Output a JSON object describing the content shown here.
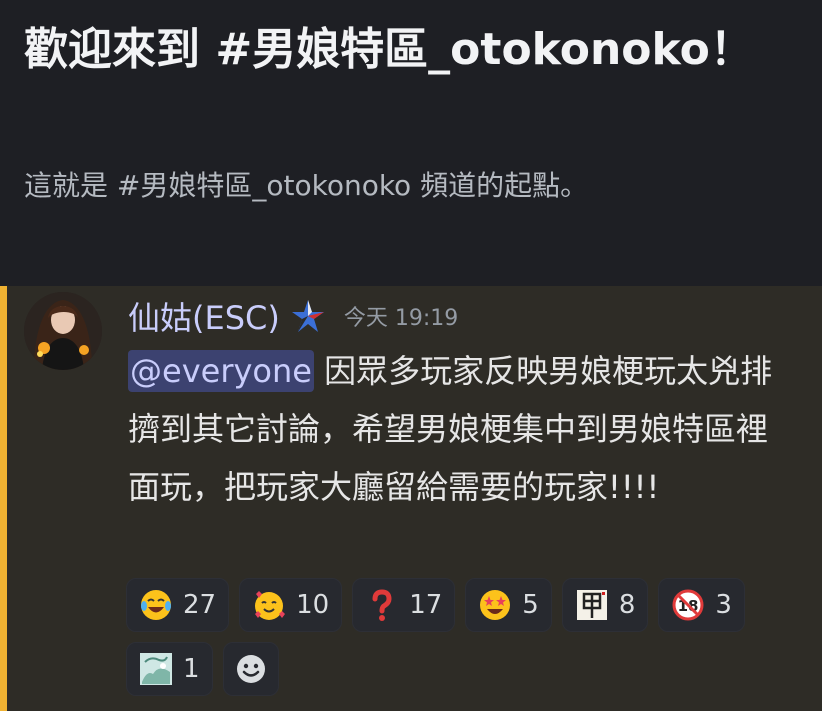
{
  "welcome": {
    "title": "歡迎來到 #男娘特區_otokonoko！",
    "subtitle": "這就是 #男娘特區_otokonoko 頻道的起點。"
  },
  "message": {
    "username": "仙姑(ESC)",
    "timestamp": "今天 19:19",
    "mention": "@everyone",
    "text": " 因眾多玩家反映男娘梗玩太兇排擠到其它討論，希望男娘梗集中到男娘特區裡面玩，把玩家大廳留給需要的玩家!!!!",
    "username_color": "#c9cdfb",
    "highlight_color": "#f0b232"
  },
  "reactions": [
    {
      "icon": "joy-tears-emoji",
      "count": "27"
    },
    {
      "icon": "smiling-hearts-emoji",
      "count": "10"
    },
    {
      "icon": "red-question-emoji",
      "count": "17"
    },
    {
      "icon": "star-struck-emoji",
      "count": "5"
    },
    {
      "icon": "jia-character-emoji",
      "count": "8"
    },
    {
      "icon": "no-under-18-emoji",
      "count": "3"
    },
    {
      "icon": "custom-image-emoji",
      "count": "1"
    }
  ],
  "add_reaction_icon": "smiley-add-icon"
}
